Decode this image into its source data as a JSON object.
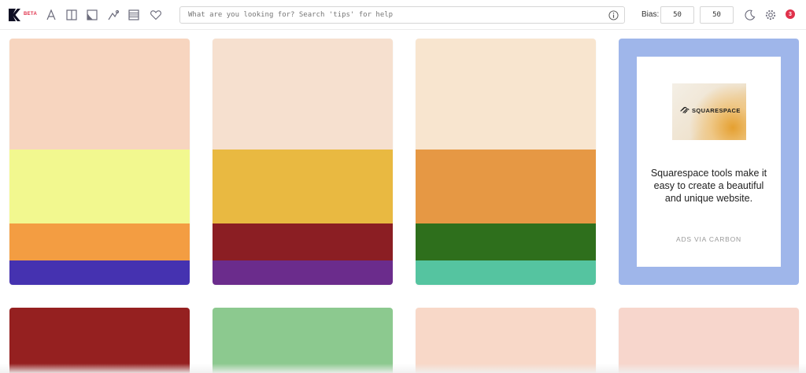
{
  "header": {
    "beta_label": "BETA",
    "tools": [
      {
        "icon": "font-icon"
      },
      {
        "icon": "columns-icon"
      },
      {
        "icon": "image-icon"
      },
      {
        "icon": "gradient-icon"
      },
      {
        "icon": "list-icon"
      },
      {
        "icon": "heart-icon"
      }
    ],
    "search": {
      "placeholder": "What are you looking for? Search 'tips' for help",
      "value": ""
    },
    "bias_label": "Bias:",
    "bias_values": [
      "50",
      "50"
    ],
    "notifications_count": "3"
  },
  "palettes_row1": [
    {
      "colors": [
        "#f7d5bf",
        "#f2f88f",
        "#f39d42",
        "#4532b0"
      ]
    },
    {
      "colors": [
        "#f6e0cf",
        "#e9b941",
        "#8b1e23",
        "#6b2c8c"
      ]
    },
    {
      "colors": [
        "#f8e5cf",
        "#e69844",
        "#2e6f1c",
        "#55c4a0"
      ]
    }
  ],
  "palettes_row2": [
    {
      "color": "#952020"
    },
    {
      "color": "#8cc98f"
    },
    {
      "color": "#f8d8c8"
    },
    {
      "color": "#f7d6cc"
    }
  ],
  "ad": {
    "brand": "SQUARESPACE",
    "text": "Squarespace tools make it easy to create a beautiful and unique website.",
    "via": "ADS VIA CARBON",
    "border_color": "#9fb6ea"
  },
  "colors": {
    "accent": "#e0314b",
    "icon": "#6b6b7b"
  }
}
